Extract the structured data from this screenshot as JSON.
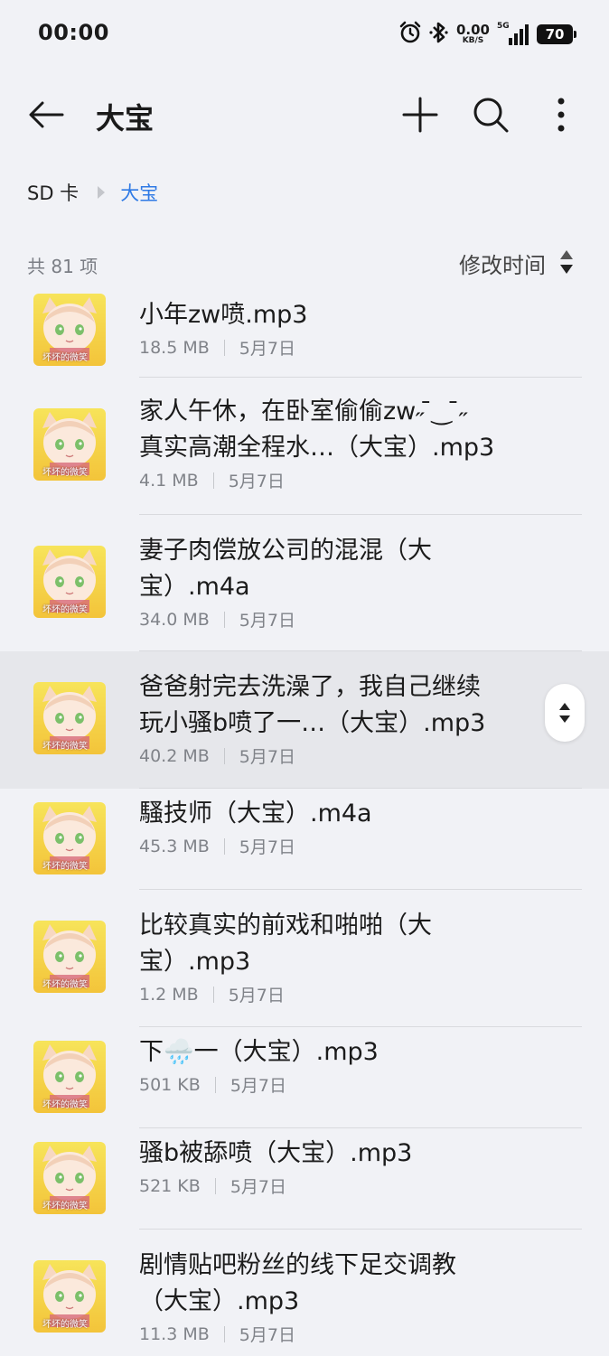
{
  "status_bar": {
    "time": "00:00",
    "net_speed_value": "0.00",
    "net_speed_unit": "KB/S",
    "network_type": "5G",
    "battery": "70",
    "icons": [
      "alarm-icon",
      "bluetooth-icon",
      "signal-icon",
      "battery-icon"
    ]
  },
  "app_bar": {
    "title": "大宝",
    "icons": [
      "back-arrow-icon",
      "plus-icon",
      "search-icon",
      "more-vertical-icon"
    ]
  },
  "breadcrumb": {
    "root": "SD 卡",
    "current": "大宝"
  },
  "list_header": {
    "count": "共 81 项",
    "sort_label": "修改时间"
  },
  "files": [
    {
      "name": "小年zw喷.mp3",
      "size": "18.5 MB",
      "date": "5月7日"
    },
    {
      "name": "家人午休，在卧室偷偷zw˶ ̄‿ ̄˶\n真实高潮全程水…（大宝）.mp3",
      "size": "4.1 MB",
      "date": "5月7日"
    },
    {
      "name": "妻子肉偿放公司的混混（大\n宝）.m4a",
      "size": "34.0 MB",
      "date": "5月7日"
    },
    {
      "name": "爸爸射完去洗澡了，我自己继续\n玩小骚b喷了一…（大宝）.mp3",
      "size": "40.2 MB",
      "date": "5月7日"
    },
    {
      "name": "騷技师（大宝）.m4a",
      "size": "45.3 MB",
      "date": "5月7日"
    },
    {
      "name": "比较真实的前戏和啪啪（大\n宝）.mp3",
      "size": "1.2 MB",
      "date": "5月7日"
    },
    {
      "name": "下🌧️一（大宝）.mp3",
      "size": "501 KB",
      "date": "5月7日"
    },
    {
      "name": "骚b被舔喷（大宝）.mp3",
      "size": "521 KB",
      "date": "5月7日"
    },
    {
      "name": "剧情贴吧粉丝的线下足交调教\n（大宝）.mp3",
      "size": "11.3 MB",
      "date": "5月7日"
    }
  ],
  "thumbnail_caption": "坏坏的微笑",
  "colors": {
    "background": "#f1f2f6",
    "accent": "#2f7ae5",
    "highlight_row": "#e6e7eb",
    "thumbnail": "#f3c43a"
  }
}
